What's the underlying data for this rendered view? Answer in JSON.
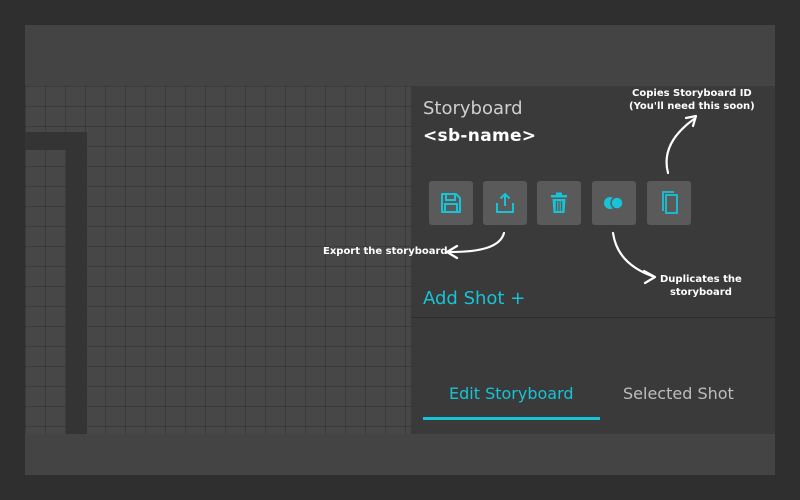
{
  "panel": {
    "title": "Storyboard",
    "name": "<sb-name>",
    "add_shot_label": "Add Shot +",
    "accent_color": "#17c3d6"
  },
  "toolbar": {
    "buttons": [
      {
        "icon": "save-icon"
      },
      {
        "icon": "export-icon"
      },
      {
        "icon": "trash-icon"
      },
      {
        "icon": "duplicate-icon"
      },
      {
        "icon": "copy-icon"
      }
    ]
  },
  "tabs": [
    {
      "label": "Edit Storyboard",
      "active": true
    },
    {
      "label": "Selected Shot",
      "active": false
    }
  ],
  "annotations": {
    "copy_id_line1": "Copies Storyboard ID",
    "copy_id_line2": "(You'll need this soon)",
    "export": "Export the storyboard",
    "duplicate_line1": "Duplicates the",
    "duplicate_line2": "storyboard"
  }
}
